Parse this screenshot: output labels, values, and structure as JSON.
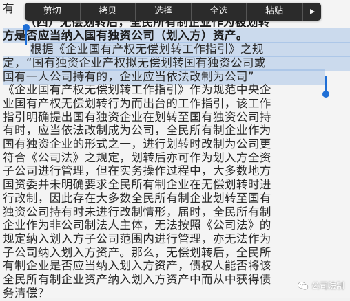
{
  "menu": {
    "items": [
      "剪切",
      "拷贝",
      "选择",
      "全选",
      "粘贴"
    ],
    "more_icon": "play-right-icon"
  },
  "article": {
    "lines": [
      {
        "text": "有",
        "style": "plain"
      },
      {
        "text": "（四）无偿划转后，全民所有制企业作为被划转",
        "style": "bold"
      },
      {
        "text": "方是否应当纳入国有独资公司（划入方）资产。",
        "style": "bold-sel"
      },
      {
        "text": "根据《企业国有产权无偿划转工作指引》之规",
        "style": "sel-indent"
      },
      {
        "text": "定，“国有独资企业产权拟无偿划转国有独资公司或",
        "style": "sel"
      },
      {
        "text": "国有一人公司持有的，企业应当依法改制为公司”",
        "style": "sel"
      },
      {
        "text": "《企业国有产权无偿划转工作指引》作为规范中央企",
        "style": "plain"
      },
      {
        "text": "业国有产权无偿划转行为而出台的工作指引，该工作",
        "style": "plain"
      },
      {
        "text": "指引明确提出国有独资企业在划转至国有独资公司持",
        "style": "plain"
      },
      {
        "text": "有时，应当依法改制成为公司，全民所有制企业作为",
        "style": "plain"
      },
      {
        "text": "国有独资企业的形式之一，进行划转时改制为公司更",
        "style": "plain"
      },
      {
        "text": "符合《公司法》之规定，划转后亦可作为划入方全资",
        "style": "plain"
      },
      {
        "text": "子公司进行管理，但在实务操作过程中，大多数地方",
        "style": "plain"
      },
      {
        "text": "国资委并未明确要求全民所有制企业在无偿划转时进",
        "style": "plain"
      },
      {
        "text": "行改制，因此存在大多数全民所有制企业划转至国有",
        "style": "plain"
      },
      {
        "text": "独资公司持有时未进行改制情形，届时，全民所有制",
        "style": "plain"
      },
      {
        "text": "企业作为非公司制法人主体，无法按照《公司法》的",
        "style": "plain"
      },
      {
        "text": "规定纳入划入方子公司范围内进行管理，亦无法作为",
        "style": "plain"
      },
      {
        "text": "子公司纳入划入方资产。那么，无偿划转后，全民所",
        "style": "plain"
      },
      {
        "text": "有制企业是否应当纳入划入方资产，债权人能否将该",
        "style": "plain"
      },
      {
        "text": "全民所有制企业资产纳入划入方资产中而从中获得债",
        "style": "plain"
      },
      {
        "text": "务清偿？",
        "style": "plain"
      }
    ]
  },
  "watermark": {
    "text": "公司法制",
    "icon": "wechat-icon"
  },
  "colors": {
    "selection": "#a9c4ea",
    "handle": "#1f6fd6",
    "menu_bg": "#2b2b2b"
  }
}
